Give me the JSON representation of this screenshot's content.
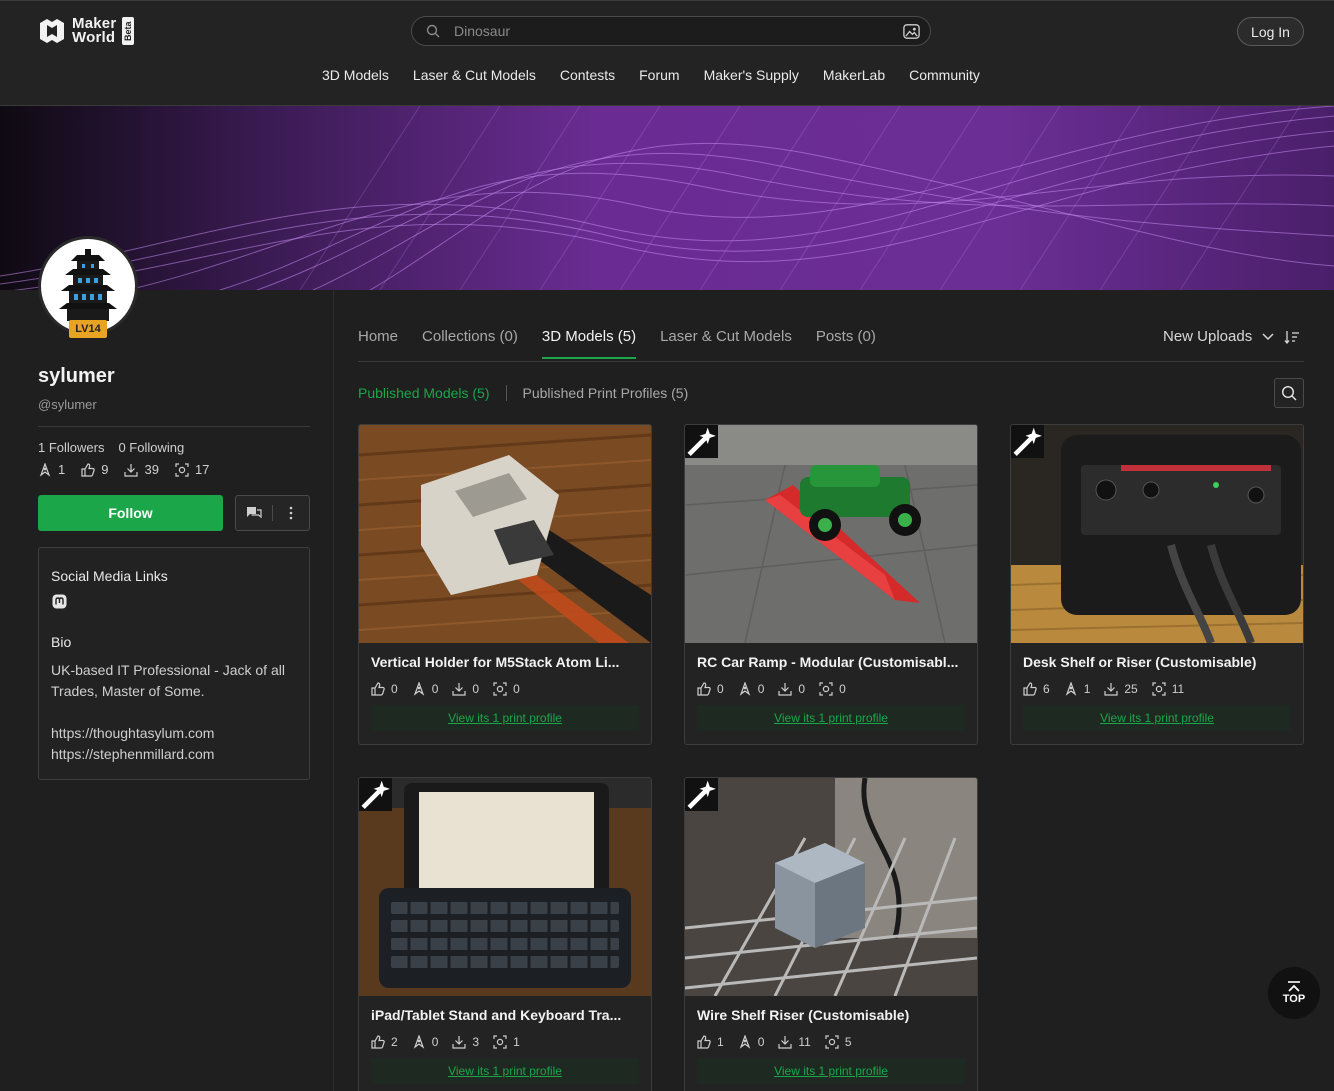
{
  "header": {
    "logo_line1": "Maker",
    "logo_line2": "World",
    "logo_beta": "Beta",
    "search_placeholder": "Dinosaur",
    "login_label": "Log In",
    "nav": [
      "3D Models",
      "Laser & Cut Models",
      "Contests",
      "Forum",
      "Maker's Supply",
      "MakerLab",
      "Community"
    ]
  },
  "profile": {
    "level": "LV14",
    "username": "sylumer",
    "handle": "@sylumer",
    "followers": "1 Followers",
    "following": "0 Following",
    "stats": {
      "boosts": "1",
      "likes": "9",
      "downloads": "39",
      "prints": "17"
    },
    "follow_label": "Follow",
    "social_title": "Social Media Links",
    "bio_title": "Bio",
    "bio_line1": "UK-based IT Professional - Jack of all",
    "bio_line2": "Trades, Master of Some.",
    "link1": "https://thoughtasylum.com",
    "link2": "https://stephenmillard.com"
  },
  "tabs": [
    "Home",
    "Collections (0)",
    "3D Models (5)",
    "Laser & Cut Models",
    "Posts (0)"
  ],
  "active_tab": "3D Models (5)",
  "sort_label": "New Uploads",
  "subtabs": {
    "published": "Published Models (5)",
    "profiles": "Published Print Profiles (5)"
  },
  "cards": [
    {
      "title": "Vertical Holder for M5Stack Atom Li...",
      "likes": "0",
      "boosts": "0",
      "downloads": "0",
      "prints": "0",
      "link": "View its 1 print profile"
    },
    {
      "title": "RC Car Ramp - Modular (Customisabl...",
      "likes": "0",
      "boosts": "0",
      "downloads": "0",
      "prints": "0",
      "link": "View its 1 print profile"
    },
    {
      "title": "Desk Shelf or Riser (Customisable)",
      "likes": "6",
      "boosts": "1",
      "downloads": "25",
      "prints": "11",
      "link": "View its 1 print profile"
    },
    {
      "title": "iPad/Tablet Stand and Keyboard Tra...",
      "likes": "2",
      "boosts": "0",
      "downloads": "3",
      "prints": "1",
      "link": "View its 1 print profile"
    },
    {
      "title": "Wire Shelf Riser (Customisable)",
      "likes": "1",
      "boosts": "0",
      "downloads": "11",
      "prints": "5",
      "link": "View its 1 print profile"
    }
  ],
  "top_label": "TOP",
  "colors": {
    "accent": "#1ba64a",
    "background": "#1f1f1f",
    "banner": "#6a2c93"
  }
}
